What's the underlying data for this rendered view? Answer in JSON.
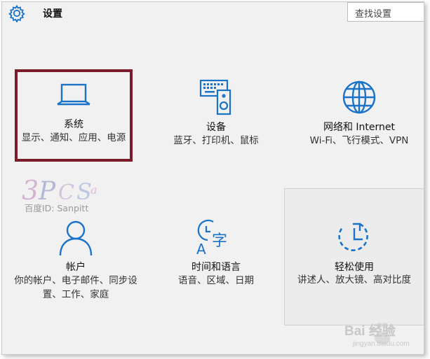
{
  "header": {
    "title": "设置",
    "search_placeholder": "查找设置"
  },
  "tiles": [
    {
      "name": "系统",
      "desc": "显示、通知、应用、电源",
      "icon": "laptop-icon"
    },
    {
      "name": "设备",
      "desc": "蓝牙、打印机、鼠标",
      "icon": "devices-icon"
    },
    {
      "name": "网络和 Internet",
      "desc": "Wi-Fi、飞行模式、VPN",
      "icon": "globe-icon"
    },
    {
      "name": "帐户",
      "desc": "你的帐户、电子邮件、同步设置、工作、家庭",
      "icon": "person-icon"
    },
    {
      "name": "时间和语言",
      "desc": "语音、区域、日期",
      "icon": "clock-language-icon"
    },
    {
      "name": "轻松使用",
      "desc": "讲述人、放大镜、高对比度",
      "icon": "ease-of-access-icon"
    }
  ],
  "watermark": {
    "logo_caption": "百度ID: Sanpitt",
    "brand": "Bai  经验",
    "site": "jingyan.baidu.com"
  },
  "colors": {
    "accent": "#1a73c9",
    "selection_border": "#7c1c2a",
    "background": "#f1f1f1"
  }
}
